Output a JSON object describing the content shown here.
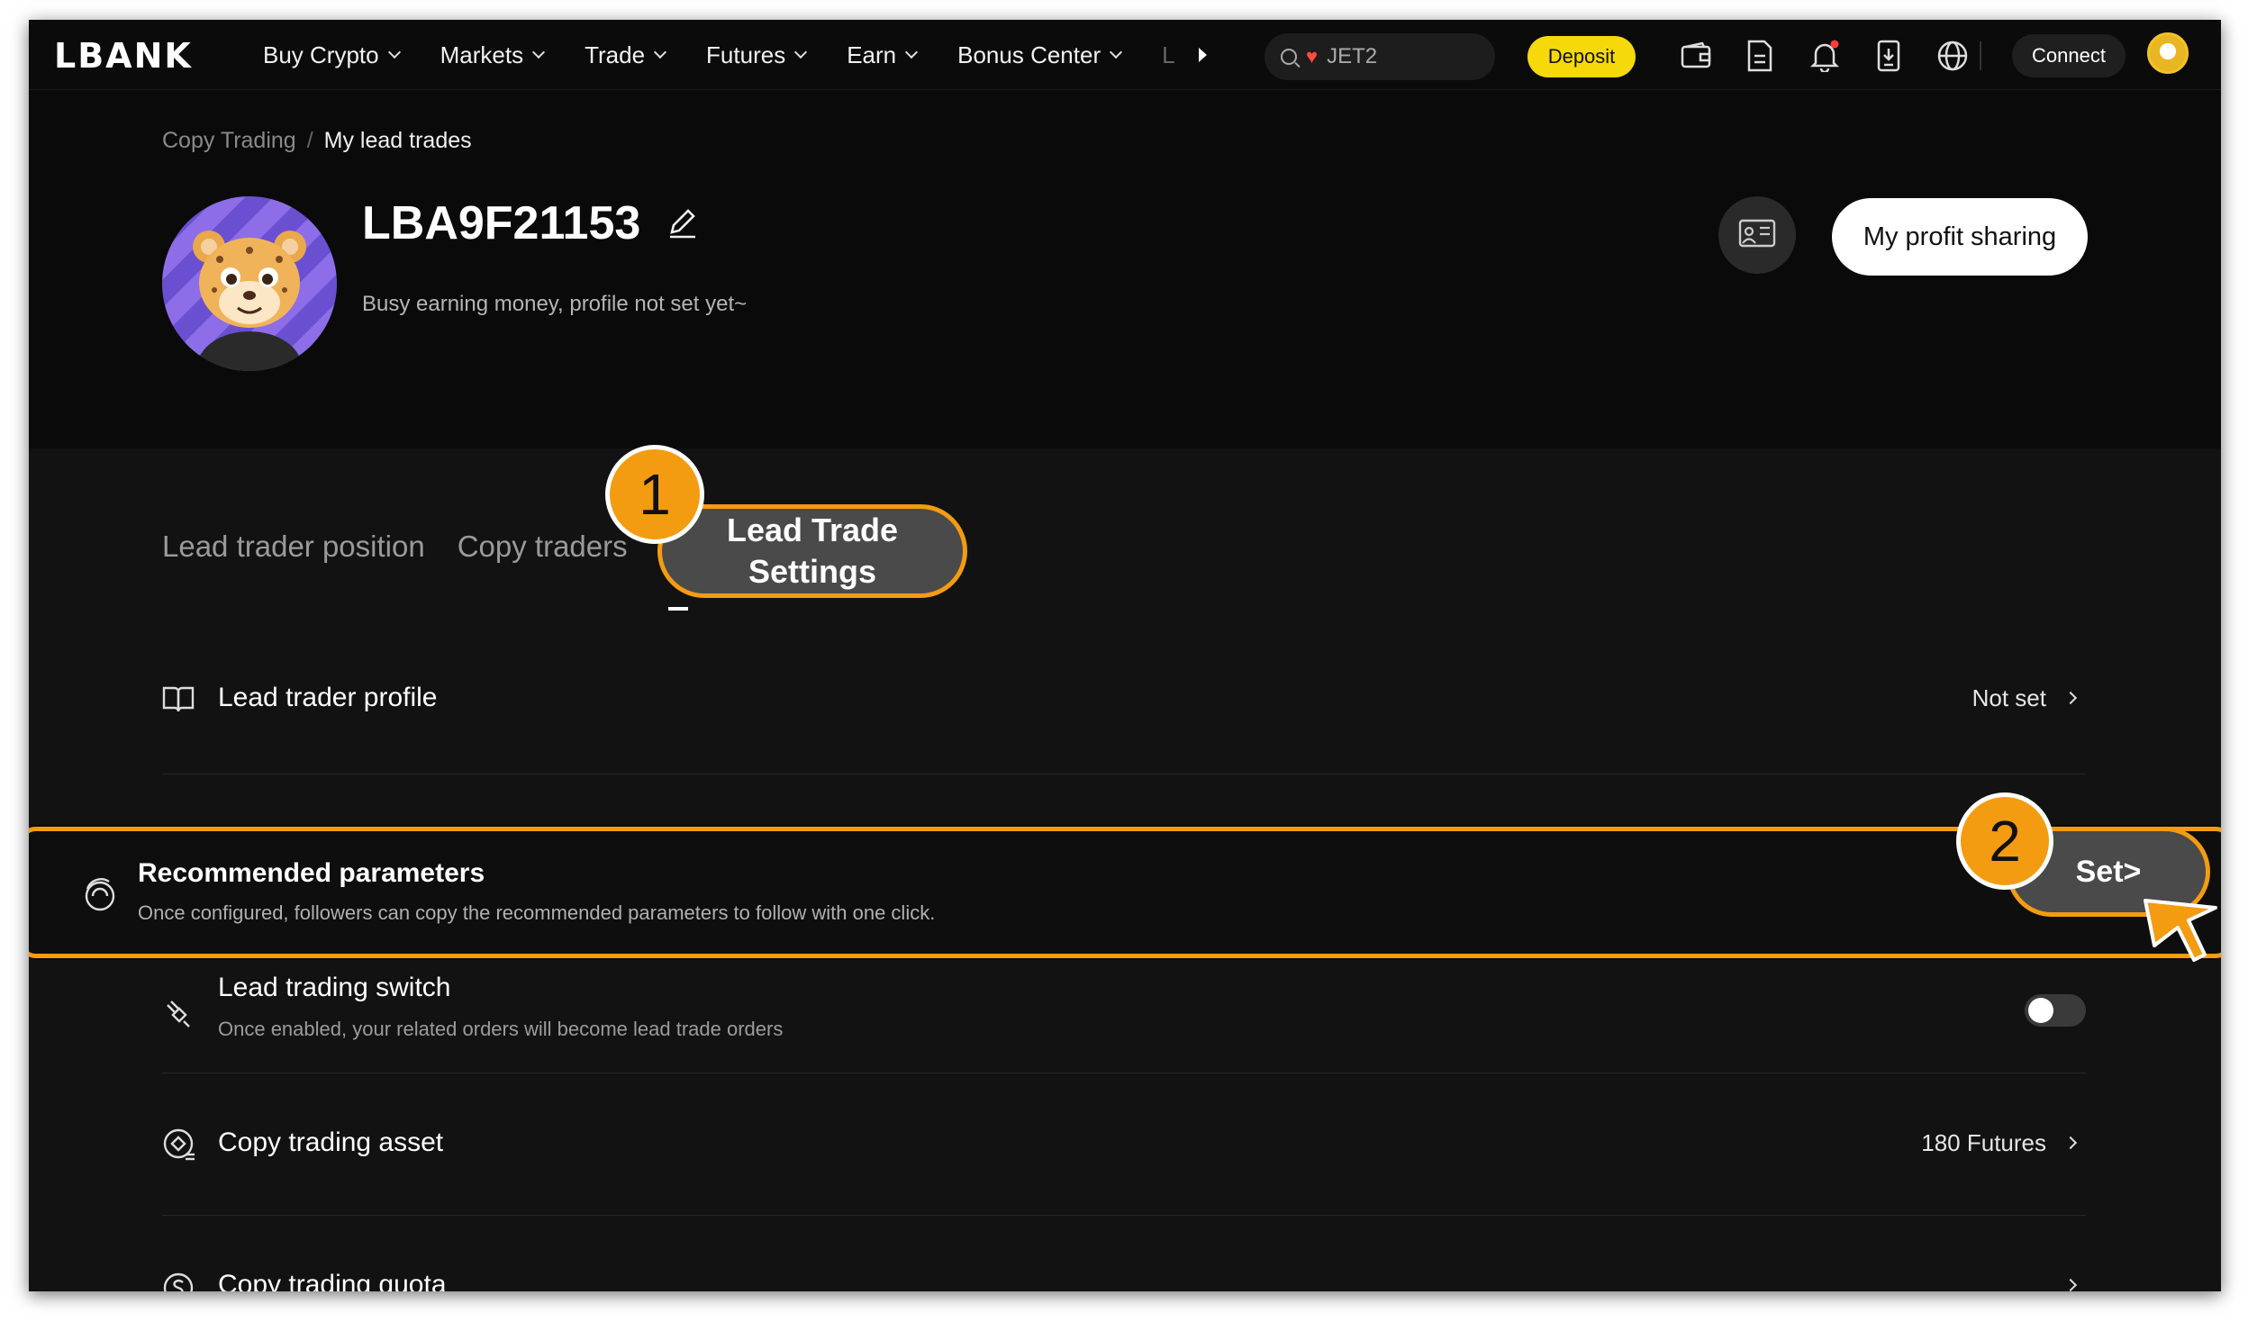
{
  "nav": {
    "logo": "LBANK",
    "menu": [
      "Buy Crypto",
      "Markets",
      "Trade",
      "Futures",
      "Earn",
      "Bonus Center"
    ],
    "more": "L",
    "search_value": "JET2",
    "deposit": "Deposit",
    "connect": "Connect"
  },
  "breadcrumb": {
    "parent": "Copy Trading",
    "separator": "/",
    "current": "My lead trades"
  },
  "profile": {
    "name": "LBA9F21153",
    "bio": "Busy earning money, profile not set yet~",
    "profit_sharing": "My profit sharing"
  },
  "tabs": [
    "Lead trader position",
    "Copy traders",
    "Lead Trade Settings"
  ],
  "rows": {
    "profile": {
      "title": "Lead trader profile",
      "value": "Not set"
    },
    "recommended": {
      "title": "Recommended parameters",
      "desc": "Once configured, followers can copy the recommended parameters to follow with one click.",
      "action": "Set>"
    },
    "switch": {
      "title": "Lead trading switch",
      "desc": "Once enabled, your related orders will become lead trade orders",
      "enabled": false
    },
    "asset": {
      "title": "Copy trading asset",
      "value": "180 Futures"
    },
    "quota": {
      "title": "Copy trading quota"
    }
  },
  "annotations": {
    "step1": "1",
    "step2": "2",
    "accent": "#f39c12"
  }
}
